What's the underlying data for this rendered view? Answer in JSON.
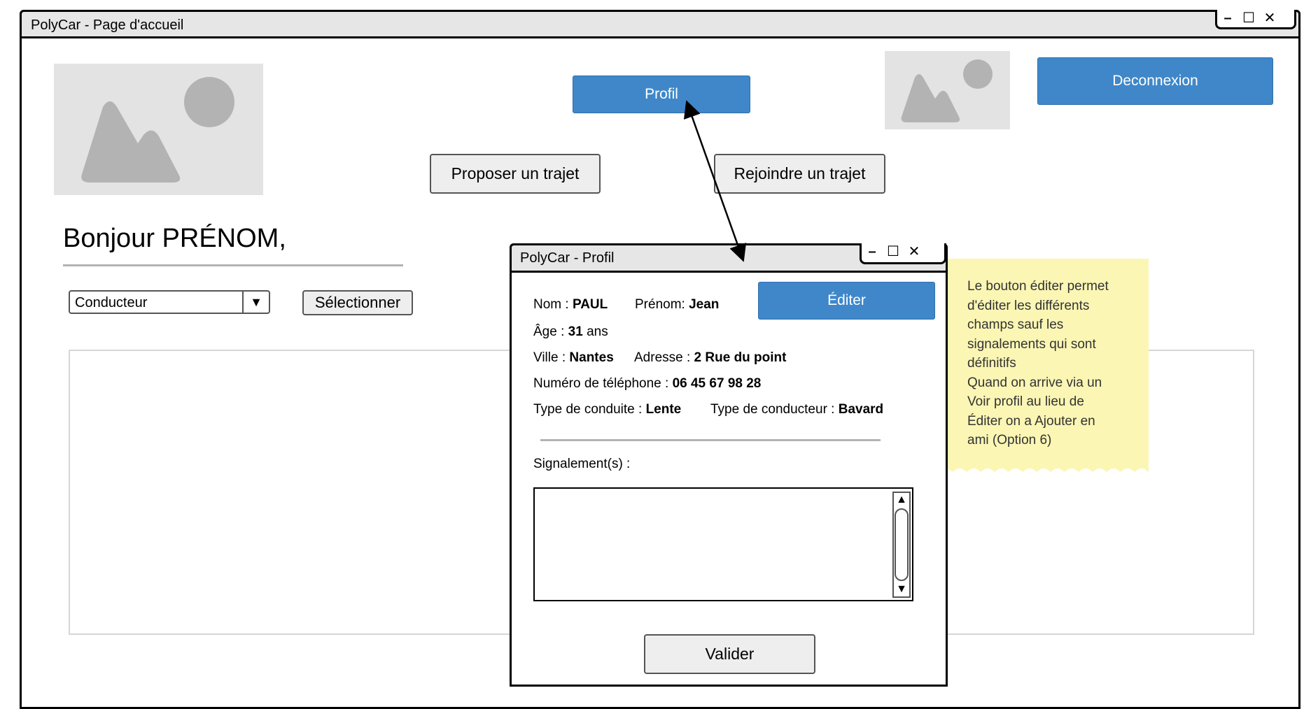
{
  "main_window": {
    "title": "PolyCar - Page d'accueil",
    "controls": {
      "minimize": "–",
      "maximize": "☐",
      "close": "✕"
    }
  },
  "header": {
    "profile_button": "Profil",
    "logout_button": "Deconnexion",
    "propose_button": "Proposer un trajet",
    "join_button": "Rejoindre un trajet"
  },
  "greeting": "Bonjour PRÉNOM,",
  "role_select": {
    "value": "Conducteur",
    "arrow": "▼"
  },
  "select_button": "Sélectionner",
  "profile_dialog": {
    "title": "PolyCar - Profil",
    "controls": {
      "minimize": "–",
      "maximize": "☐",
      "close": "✕"
    },
    "edit_button": "Éditer",
    "fields": {
      "nom_label": "Nom : ",
      "nom_value": "PAUL",
      "prenom_label": "Prénom: ",
      "prenom_value": "Jean",
      "age_label": "Âge : ",
      "age_value": "31",
      "age_unit": " ans",
      "ville_label": "Ville : ",
      "ville_value": "Nantes",
      "adresse_label": "Adresse : ",
      "adresse_value": "2 Rue du point",
      "tel_label": "Numéro de téléphone : ",
      "tel_value": "06 45 67 98 28",
      "conduite_label": "Type de conduite : ",
      "conduite_value": "Lente",
      "conducteur_label": "Type de conducteur : ",
      "conducteur_value": "Bavard"
    },
    "reports_label": "Signalement(s) :",
    "scroll_up": "▲",
    "scroll_down": "▼",
    "validate_button": "Valider"
  },
  "note": {
    "lines": [
      "Le bouton éditer permet",
      "d'éditer les différents",
      "champs sauf les",
      "signalements qui sont",
      "définitifs",
      "Quand on arrive via un",
      "Voir profil au lieu de",
      "Éditer on a Ajouter en",
      "ami (Option 6)"
    ]
  }
}
